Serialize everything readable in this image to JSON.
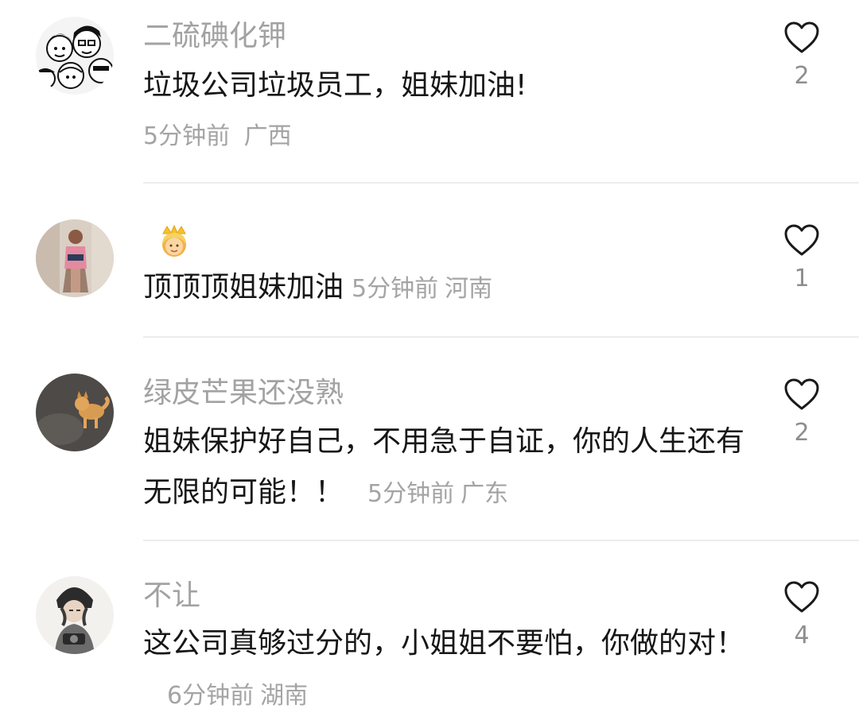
{
  "comments": [
    {
      "username": "二硫碘化钾",
      "text": "垃圾公司垃圾员工，姐妹加油!",
      "time": "5分钟前",
      "location": "广西",
      "likes": "2",
      "avatar_icon": "cartoon-crowd-avatar"
    },
    {
      "username": "",
      "badge_icon": "princess-emoji-icon",
      "text": "顶顶顶姐妹加油",
      "time": "5分钟前",
      "location": "河南",
      "likes": "1",
      "avatar_icon": "girl-photo-avatar"
    },
    {
      "username": "绿皮芒果还没熟",
      "text": "姐妹保护好自己，不用急于自证，你的人生还有无限的可能！！",
      "time": "5分钟前",
      "location": "广东",
      "likes": "2",
      "avatar_icon": "shiba-dog-avatar"
    },
    {
      "username": "不让",
      "text": "这公司真够过分的，小姐姐不要怕，你做的对！",
      "time": "6分钟前",
      "location": "湖南",
      "likes": "4",
      "avatar_icon": "anime-boy-avatar"
    }
  ],
  "colors": {
    "username": "#a2a2a2",
    "text": "#161616",
    "meta": "#a4a4a4",
    "like_count": "#8e8e8e",
    "heart_outline": "#1a1a1a",
    "divider": "#ececec"
  },
  "icons": {
    "like": "heart-outline-icon"
  }
}
